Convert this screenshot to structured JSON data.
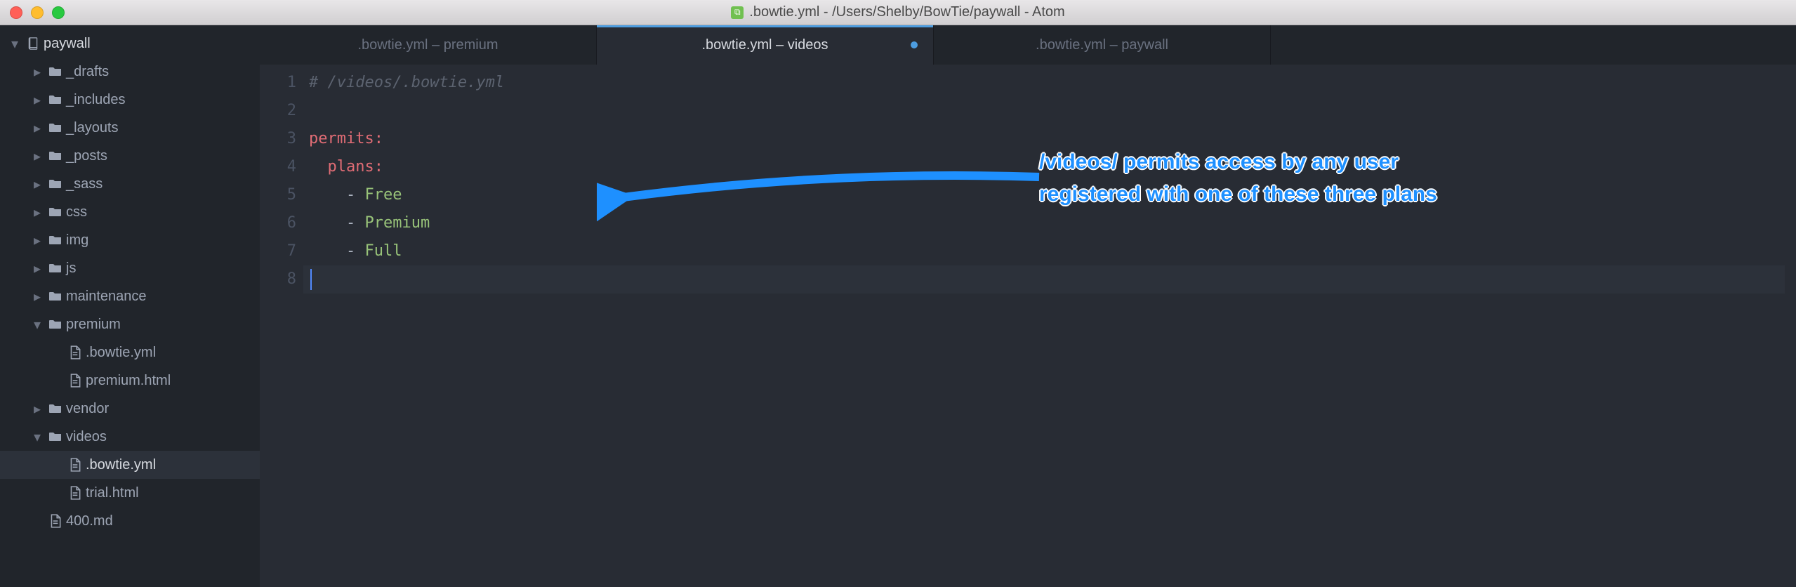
{
  "window": {
    "title": ".bowtie.yml - /Users/Shelby/BowTie/paywall - Atom"
  },
  "sidebar": {
    "root": "paywall",
    "items": [
      {
        "type": "folder",
        "name": "_drafts",
        "depth": 1,
        "expanded": false
      },
      {
        "type": "folder",
        "name": "_includes",
        "depth": 1,
        "expanded": false
      },
      {
        "type": "folder",
        "name": "_layouts",
        "depth": 1,
        "expanded": false
      },
      {
        "type": "folder",
        "name": "_posts",
        "depth": 1,
        "expanded": false
      },
      {
        "type": "folder",
        "name": "_sass",
        "depth": 1,
        "expanded": false
      },
      {
        "type": "folder",
        "name": "css",
        "depth": 1,
        "expanded": false
      },
      {
        "type": "folder",
        "name": "img",
        "depth": 1,
        "expanded": false
      },
      {
        "type": "folder",
        "name": "js",
        "depth": 1,
        "expanded": false
      },
      {
        "type": "folder",
        "name": "maintenance",
        "depth": 1,
        "expanded": false
      },
      {
        "type": "folder",
        "name": "premium",
        "depth": 1,
        "expanded": true
      },
      {
        "type": "file",
        "name": ".bowtie.yml",
        "depth": 2
      },
      {
        "type": "file",
        "name": "premium.html",
        "depth": 2
      },
      {
        "type": "folder",
        "name": "vendor",
        "depth": 1,
        "expanded": false
      },
      {
        "type": "folder",
        "name": "videos",
        "depth": 1,
        "expanded": true
      },
      {
        "type": "file",
        "name": ".bowtie.yml",
        "depth": 2,
        "selected": true
      },
      {
        "type": "file",
        "name": "trial.html",
        "depth": 2
      },
      {
        "type": "file",
        "name": "400.md",
        "depth": 1
      }
    ]
  },
  "tabs": [
    {
      "label": ".bowtie.yml – premium",
      "active": false,
      "modified": false
    },
    {
      "label": ".bowtie.yml – videos",
      "active": true,
      "modified": true
    },
    {
      "label": ".bowtie.yml – paywall",
      "active": false,
      "modified": false
    }
  ],
  "editor": {
    "lines": {
      "l1_comment": "# /videos/.bowtie.yml",
      "l3_key": "permits:",
      "l4_key": "plans:",
      "l5_val": "Free",
      "l6_val": "Premium",
      "l7_val": "Full"
    },
    "line_numbers": [
      "1",
      "2",
      "3",
      "4",
      "5",
      "6",
      "7",
      "8"
    ]
  },
  "annotation": {
    "line1": "/videos/ permits access by any user",
    "line2": "registered with one of these three plans"
  }
}
